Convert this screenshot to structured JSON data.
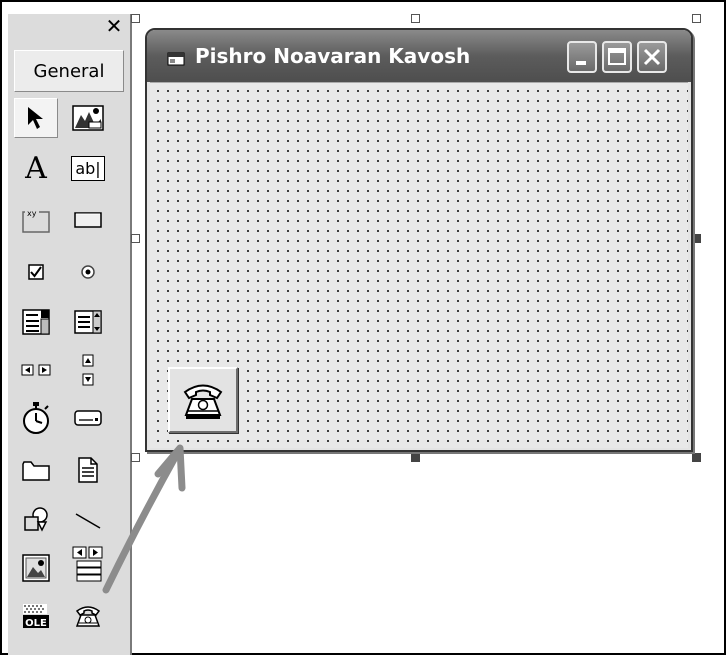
{
  "toolbox": {
    "close_glyph": "✕",
    "tab_label": "General",
    "tools": [
      {
        "name": "pointer-icon"
      },
      {
        "name": "picture-box-icon"
      },
      {
        "name": "label-icon",
        "glyph": "A"
      },
      {
        "name": "textbox-icon",
        "glyph": "ab|"
      },
      {
        "name": "frame-icon",
        "glyph": "xy"
      },
      {
        "name": "command-button-icon"
      },
      {
        "name": "checkbox-icon"
      },
      {
        "name": "option-button-icon"
      },
      {
        "name": "combobox-icon"
      },
      {
        "name": "listbox-icon"
      },
      {
        "name": "hscrollbar-icon"
      },
      {
        "name": "vscrollbar-icon"
      },
      {
        "name": "timer-icon"
      },
      {
        "name": "drivelistbox-icon"
      },
      {
        "name": "dirlistbox-icon"
      },
      {
        "name": "filelistbox-icon"
      },
      {
        "name": "shape-icon"
      },
      {
        "name": "line-icon"
      },
      {
        "name": "image-icon"
      },
      {
        "name": "data-icon"
      },
      {
        "name": "ole-icon",
        "glyph": "OLE"
      },
      {
        "name": "msComm-telephone-icon"
      }
    ]
  },
  "form": {
    "title": "Pishro Noavaran Kavosh",
    "title_icon": "form-icon",
    "buttons": [
      "minimize-icon",
      "maximize-icon",
      "close-icon"
    ],
    "control": "telephone-icon"
  },
  "colors": {
    "arrow": "#8c8c8c",
    "titlebar": "#5c5c5c",
    "toolbox_bg": "#dcdcdc"
  }
}
